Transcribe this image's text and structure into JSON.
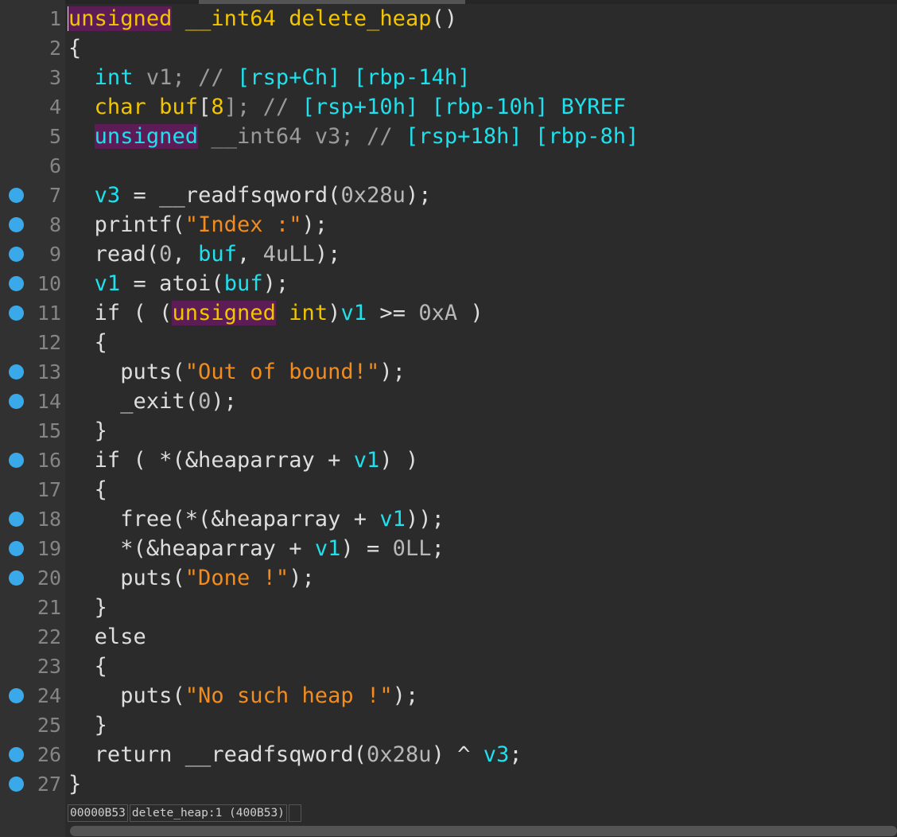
{
  "editor": {
    "lines": [
      {
        "n": "1",
        "bp": false,
        "segs": [
          [
            "unsigned",
            "type hl"
          ],
          [
            " ",
            "plain"
          ],
          [
            "__int64",
            "type"
          ],
          [
            " delete_heap",
            "type"
          ],
          [
            "()",
            "plain"
          ]
        ]
      },
      {
        "n": "2",
        "bp": false,
        "segs": [
          [
            "{",
            "plain"
          ]
        ]
      },
      {
        "n": "3",
        "bp": false,
        "segs": [
          [
            "  ",
            "plain"
          ],
          [
            "int",
            "cyan"
          ],
          [
            " v1; // ",
            "dim"
          ],
          [
            "[rsp+Ch] [rbp-14h]",
            "cyan"
          ]
        ]
      },
      {
        "n": "4",
        "bp": false,
        "segs": [
          [
            "  ",
            "plain"
          ],
          [
            "char",
            "type"
          ],
          [
            " ",
            "plain"
          ],
          [
            "buf",
            "type"
          ],
          [
            "[",
            "plain"
          ],
          [
            "8",
            "type"
          ],
          [
            "]; // ",
            "dim"
          ],
          [
            "[rsp+10h] [rbp-10h] BYREF",
            "cyan"
          ]
        ]
      },
      {
        "n": "5",
        "bp": false,
        "segs": [
          [
            "  ",
            "plain"
          ],
          [
            "unsigned",
            "cyan hl"
          ],
          [
            " __int64",
            "dim"
          ],
          [
            " v3; // ",
            "dim"
          ],
          [
            "[rsp+18h] [rbp-8h]",
            "cyan"
          ]
        ]
      },
      {
        "n": "6",
        "bp": false,
        "segs": [
          [
            "",
            "plain"
          ]
        ]
      },
      {
        "n": "7",
        "bp": true,
        "segs": [
          [
            "  ",
            "plain"
          ],
          [
            "v3",
            "cyan"
          ],
          [
            " = __readfsqword(",
            "plain"
          ],
          [
            "0x28u",
            "num"
          ],
          [
            ");",
            "plain"
          ]
        ]
      },
      {
        "n": "8",
        "bp": true,
        "segs": [
          [
            "  printf(",
            "plain"
          ],
          [
            "\"Index :\"",
            "str"
          ],
          [
            ");",
            "plain"
          ]
        ]
      },
      {
        "n": "9",
        "bp": true,
        "segs": [
          [
            "  read(",
            "plain"
          ],
          [
            "0",
            "num"
          ],
          [
            ", ",
            "plain"
          ],
          [
            "buf",
            "cyan"
          ],
          [
            ", ",
            "plain"
          ],
          [
            "4uLL",
            "num"
          ],
          [
            ");",
            "plain"
          ]
        ]
      },
      {
        "n": "10",
        "bp": true,
        "segs": [
          [
            "  ",
            "plain"
          ],
          [
            "v1",
            "cyan"
          ],
          [
            " = atoi(",
            "plain"
          ],
          [
            "buf",
            "cyan"
          ],
          [
            ");",
            "plain"
          ]
        ]
      },
      {
        "n": "11",
        "bp": true,
        "segs": [
          [
            "  if ( (",
            "plain"
          ],
          [
            "unsigned",
            "type hl"
          ],
          [
            " ",
            "plain"
          ],
          [
            "int",
            "type"
          ],
          [
            ")",
            "plain"
          ],
          [
            "v1",
            "cyan"
          ],
          [
            " >= ",
            "plain"
          ],
          [
            "0xA",
            "num"
          ],
          [
            " )",
            "plain"
          ]
        ]
      },
      {
        "n": "12",
        "bp": false,
        "segs": [
          [
            "  {",
            "plain"
          ]
        ]
      },
      {
        "n": "13",
        "bp": true,
        "segs": [
          [
            "    puts(",
            "plain"
          ],
          [
            "\"Out of bound!\"",
            "str"
          ],
          [
            ");",
            "plain"
          ]
        ]
      },
      {
        "n": "14",
        "bp": true,
        "segs": [
          [
            "    _exit(",
            "plain"
          ],
          [
            "0",
            "num"
          ],
          [
            ");",
            "plain"
          ]
        ]
      },
      {
        "n": "15",
        "bp": false,
        "segs": [
          [
            "  }",
            "plain"
          ]
        ]
      },
      {
        "n": "16",
        "bp": true,
        "segs": [
          [
            "  if ( *(&heaparray + ",
            "plain"
          ],
          [
            "v1",
            "cyan"
          ],
          [
            ") )",
            "plain"
          ]
        ]
      },
      {
        "n": "17",
        "bp": false,
        "segs": [
          [
            "  {",
            "plain"
          ]
        ]
      },
      {
        "n": "18",
        "bp": true,
        "segs": [
          [
            "    free(*(&heaparray + ",
            "plain"
          ],
          [
            "v1",
            "cyan"
          ],
          [
            "));",
            "plain"
          ]
        ]
      },
      {
        "n": "19",
        "bp": true,
        "segs": [
          [
            "    *(&heaparray + ",
            "plain"
          ],
          [
            "v1",
            "cyan"
          ],
          [
            ") = ",
            "plain"
          ],
          [
            "0LL",
            "num"
          ],
          [
            ";",
            "plain"
          ]
        ]
      },
      {
        "n": "20",
        "bp": true,
        "segs": [
          [
            "    puts(",
            "plain"
          ],
          [
            "\"Done !\"",
            "str"
          ],
          [
            ");",
            "plain"
          ]
        ]
      },
      {
        "n": "21",
        "bp": false,
        "segs": [
          [
            "  }",
            "plain"
          ]
        ]
      },
      {
        "n": "22",
        "bp": false,
        "segs": [
          [
            "  else",
            "plain"
          ]
        ]
      },
      {
        "n": "23",
        "bp": false,
        "segs": [
          [
            "  {",
            "plain"
          ]
        ]
      },
      {
        "n": "24",
        "bp": true,
        "segs": [
          [
            "    puts(",
            "plain"
          ],
          [
            "\"No such heap !\"",
            "str"
          ],
          [
            ");",
            "plain"
          ]
        ]
      },
      {
        "n": "25",
        "bp": false,
        "segs": [
          [
            "  }",
            "plain"
          ]
        ]
      },
      {
        "n": "26",
        "bp": true,
        "segs": [
          [
            "  return __readfsqword(",
            "plain"
          ],
          [
            "0x28u",
            "num"
          ],
          [
            ") ^ ",
            "plain"
          ],
          [
            "v3",
            "cyan"
          ],
          [
            ";",
            "plain"
          ]
        ]
      },
      {
        "n": "27",
        "bp": true,
        "segs": [
          [
            "}",
            "plain"
          ]
        ]
      }
    ]
  },
  "status": {
    "address": "00000B53",
    "location": "delete_heap:1 (400B53)"
  },
  "colors": {
    "background": "#2b2b2b",
    "keyword_type": "#f2c500",
    "identifier_cyan": "#1fe0ec",
    "string": "#f38c1e",
    "breakpoint": "#3aa9e9",
    "highlight": "#5c1d56"
  }
}
